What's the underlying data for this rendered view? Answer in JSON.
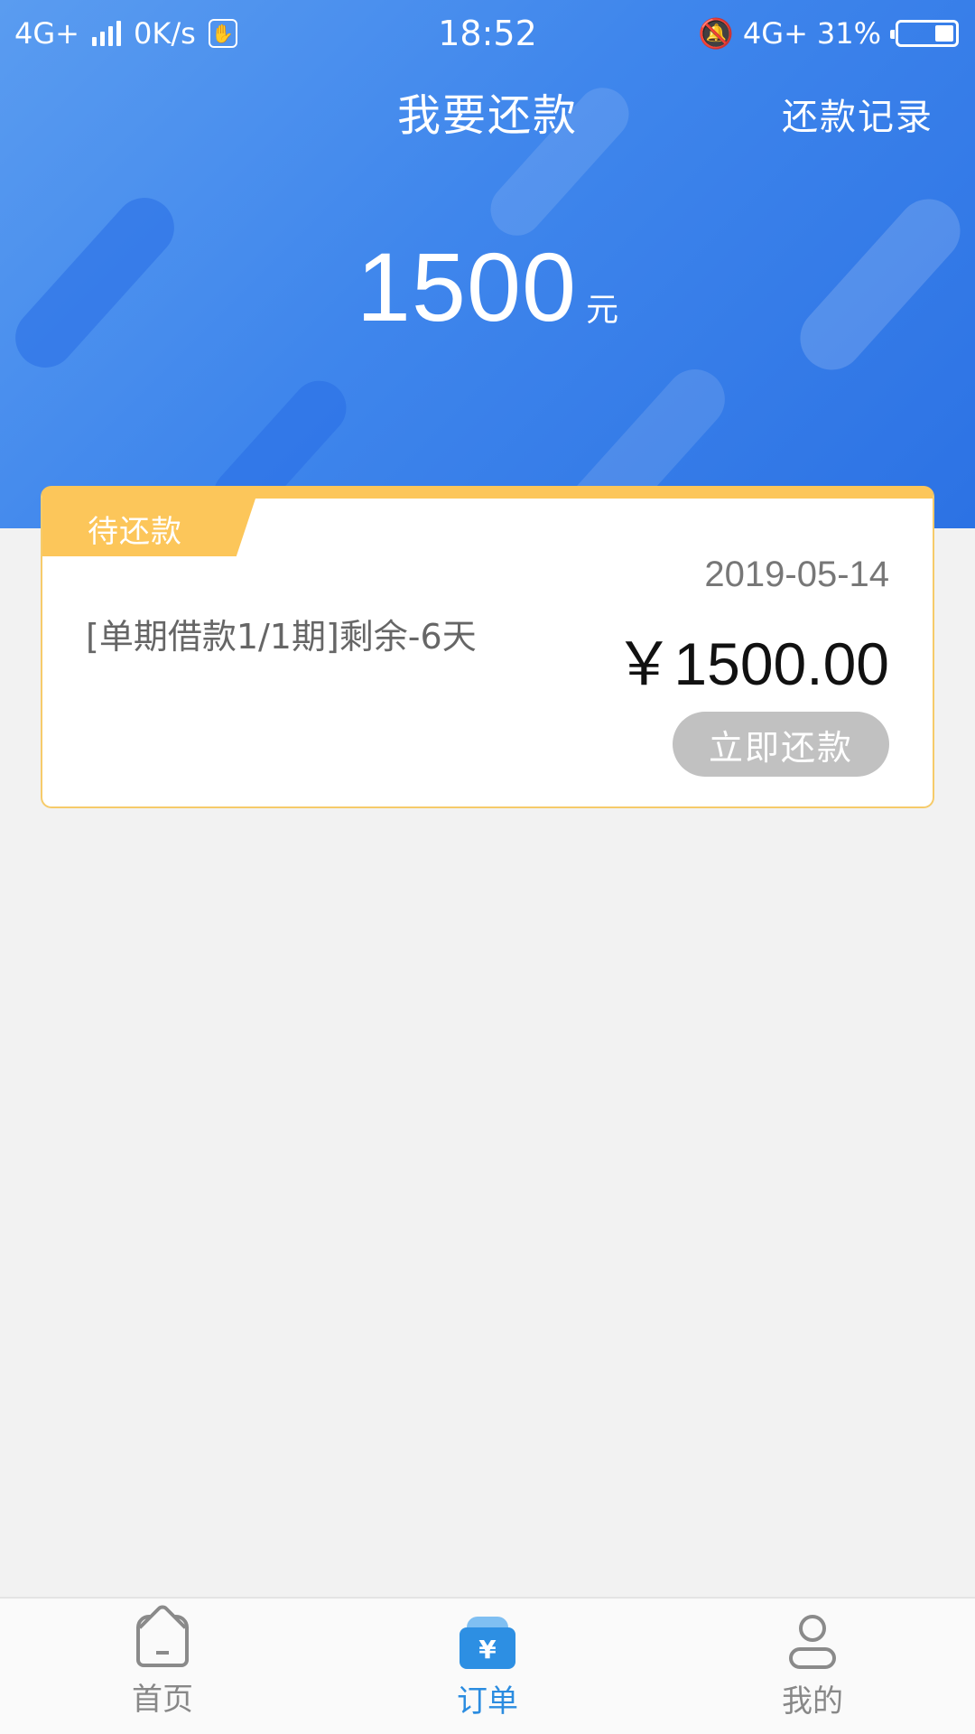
{
  "status_bar": {
    "network": "4G+",
    "speed": "0K/s",
    "time": "18:52",
    "network_right": "4G+",
    "battery": "31%",
    "battery_level": 0.31
  },
  "header": {
    "title": "我要还款",
    "history_link": "还款记录"
  },
  "total": {
    "amount": "1500",
    "unit": "元"
  },
  "card": {
    "tag": "待还款",
    "description": "[单期借款1/1期]剩余-6天",
    "date": "2019-05-14",
    "amount": "￥1500.00",
    "button": "立即还款"
  },
  "bottom_nav": {
    "items": [
      {
        "label": "首页",
        "icon": "home-icon",
        "active": false
      },
      {
        "label": "订单",
        "icon": "order-bag-icon",
        "active": true
      },
      {
        "label": "我的",
        "icon": "user-icon",
        "active": false
      }
    ]
  },
  "colors": {
    "header_blue": "#3f86ec",
    "tag_yellow": "#fcc65a",
    "active_nav": "#2b8ce0",
    "button_gray": "#c1c1c1"
  }
}
